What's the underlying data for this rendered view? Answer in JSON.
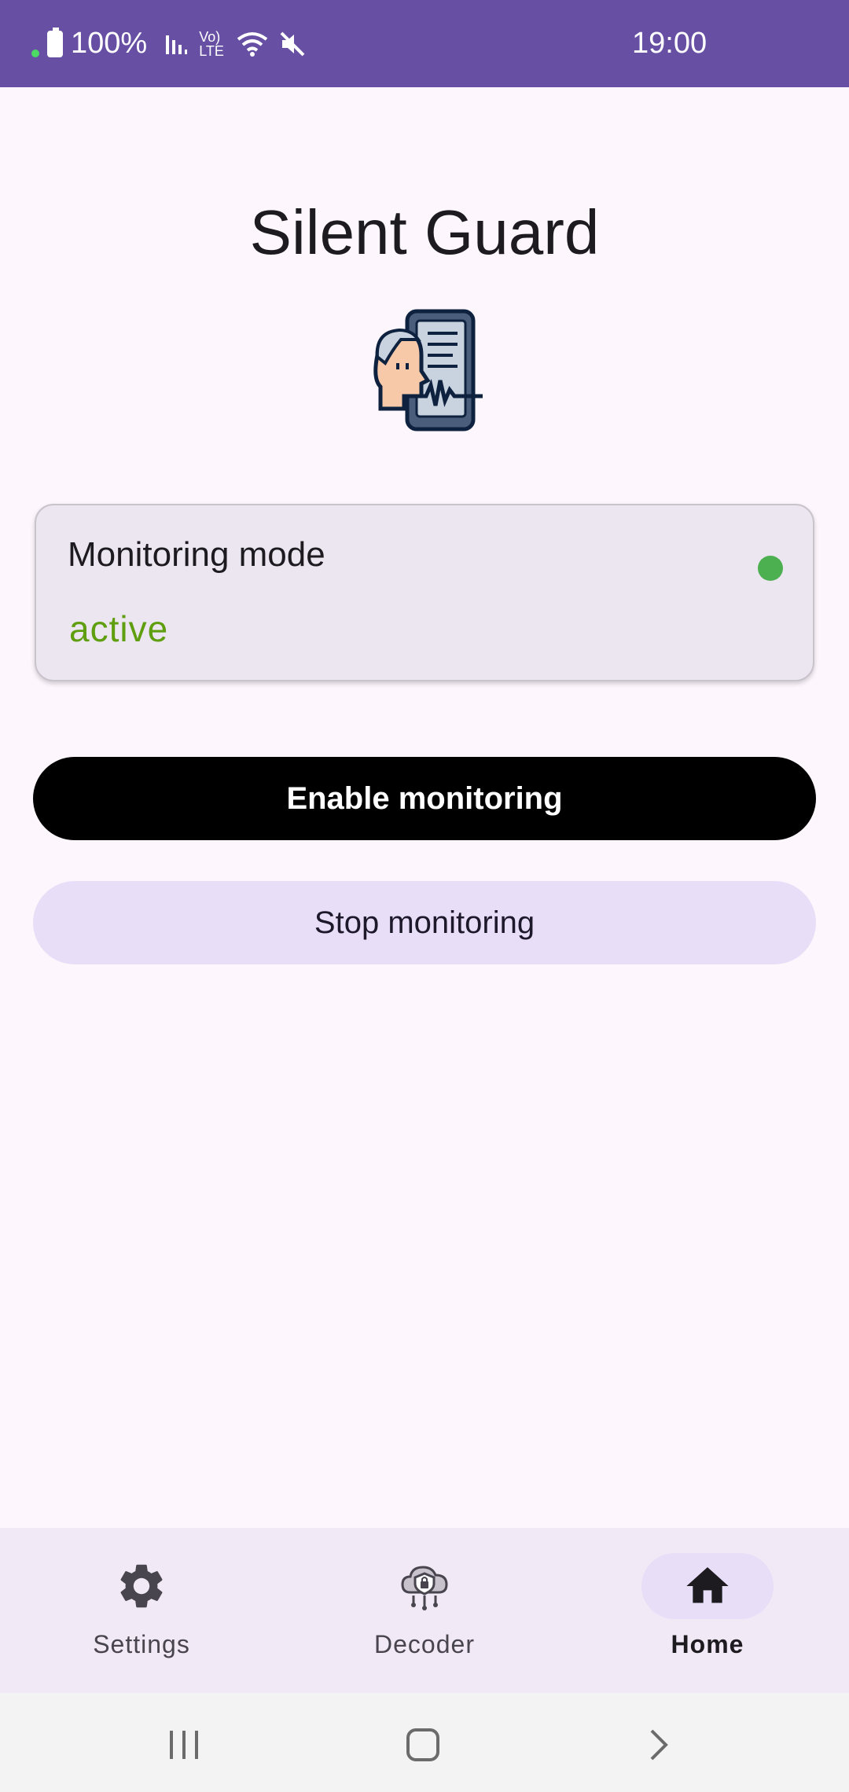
{
  "status_bar": {
    "battery": "100%",
    "network": "Vo) LTE",
    "time": "19:00"
  },
  "app": {
    "title": "Silent Guard",
    "logo_icon": "face-document-waveform-icon"
  },
  "monitoring_card": {
    "title": "Monitoring mode",
    "status": "active",
    "status_color": "#5E9E0F",
    "indicator_color": "#4CAF50"
  },
  "buttons": {
    "enable_label": "Enable monitoring",
    "stop_label": "Stop monitoring"
  },
  "bottom_nav": {
    "items": [
      {
        "label": "Settings",
        "icon": "gear-icon",
        "active": false
      },
      {
        "label": "Decoder",
        "icon": "cloud-shield-icon",
        "active": false
      },
      {
        "label": "Home",
        "icon": "home-icon",
        "active": true
      }
    ]
  },
  "colors": {
    "status_bar": "#6750A4",
    "background": "#FDF7FD",
    "card": "#ECE6F0",
    "primary_button": "#000000",
    "secondary_button": "#E8DEF8",
    "nav_bar": "#F1E9F5"
  }
}
